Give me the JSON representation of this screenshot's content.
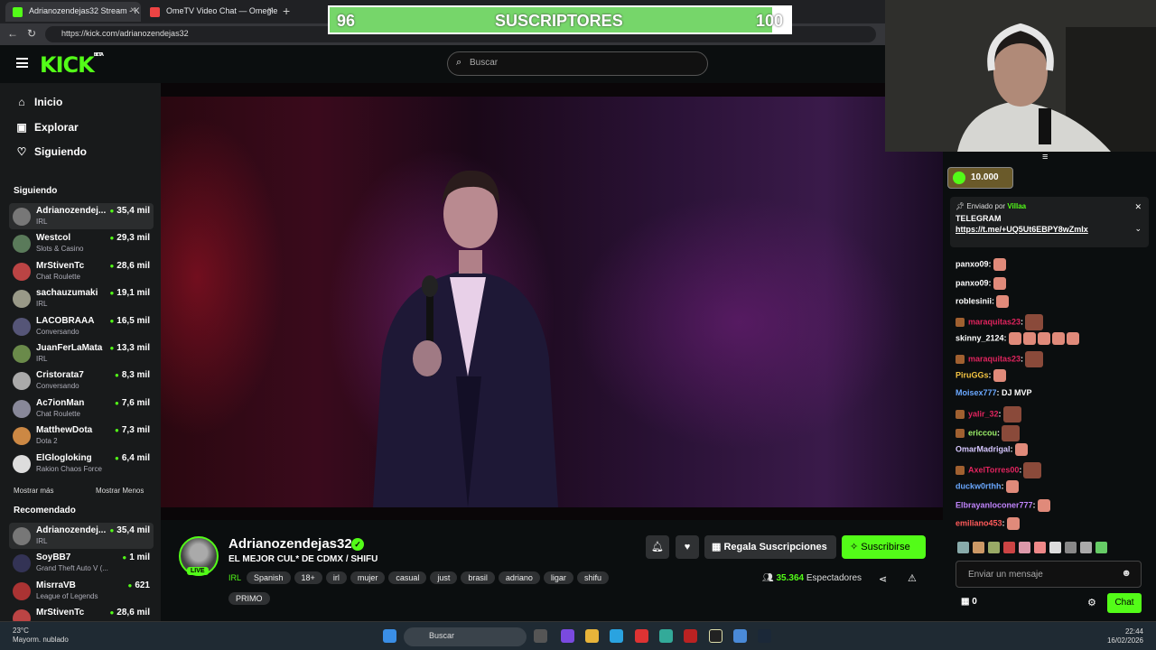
{
  "browser": {
    "tabs": [
      {
        "label": "Adrianozendejas32 Stream - K",
        "active": true,
        "favicon_color": "#53fc18"
      },
      {
        "label": "OmeTV Video Chat — Omegle Ra",
        "active": false,
        "favicon_color": "#e44"
      }
    ],
    "url": "https://kick.com/adrianozendejas32"
  },
  "sub_goal": {
    "current": "96",
    "label": "SUSCRIPTORES",
    "target": "100",
    "progress": 0.96
  },
  "header": {
    "logo": "KICK",
    "logo_badge": "BETA",
    "search_placeholder": "Buscar"
  },
  "sidebar": {
    "nav": [
      {
        "label": "Inicio",
        "icon": "home-icon"
      },
      {
        "label": "Explorar",
        "icon": "compass-icon"
      },
      {
        "label": "Siguiendo",
        "icon": "heart-icon"
      }
    ],
    "following_title": "Siguiendo",
    "following": [
      {
        "name": "Adrianozendej...",
        "category": "IRL",
        "viewers": "35,4 mil",
        "avatar_color": "#777"
      },
      {
        "name": "Westcol",
        "category": "Slots & Casino",
        "viewers": "29,3 mil",
        "avatar_color": "#5a7a5a"
      },
      {
        "name": "MrStivenTc",
        "category": "Chat Roulette",
        "viewers": "28,6 mil",
        "avatar_color": "#b44"
      },
      {
        "name": "sachauzumaki",
        "category": "IRL",
        "viewers": "19,1 mil",
        "avatar_color": "#998"
      },
      {
        "name": "LACOBRAAA",
        "category": "Conversando",
        "viewers": "16,5 mil",
        "avatar_color": "#557"
      },
      {
        "name": "JuanFerLaMata",
        "category": "IRL",
        "viewers": "13,3 mil",
        "avatar_color": "#6a8a4a"
      },
      {
        "name": "Cristorata7",
        "category": "Conversando",
        "viewers": "8,3 mil",
        "avatar_color": "#aaa"
      },
      {
        "name": "Ac7ionMan",
        "category": "Chat Roulette",
        "viewers": "7,6 mil",
        "avatar_color": "#889"
      },
      {
        "name": "MatthewDota",
        "category": "Dota 2",
        "viewers": "7,3 mil",
        "avatar_color": "#c84"
      },
      {
        "name": "ElGlogloking",
        "category": "Rakion Chaos Force",
        "viewers": "6,4 mil",
        "avatar_color": "#ddd"
      }
    ],
    "show_more": "Mostrar más",
    "show_less": "Mostrar Menos",
    "recommended_title": "Recomendado",
    "recommended": [
      {
        "name": "Adrianozendej...",
        "category": "IRL",
        "viewers": "35,4 mil",
        "avatar_color": "#777"
      },
      {
        "name": "SoyBB7",
        "category": "Grand Theft Auto V (...",
        "viewers": "1 mil",
        "avatar_color": "#335"
      },
      {
        "name": "MisrraVB",
        "category": "League of Legends",
        "viewers": "621",
        "avatar_color": "#a33"
      },
      {
        "name": "MrStivenTc",
        "category": "",
        "viewers": "28,6 mil",
        "avatar_color": "#b44"
      }
    ]
  },
  "stream": {
    "streamer": "Adrianozendejas32",
    "live_label": "LIVE",
    "title": "EL MEJOR CUL* DE CDMX  / SHIFU",
    "category": "IRL",
    "tags": [
      "Spanish",
      "18+",
      "irl",
      "mujer",
      "casual",
      "just",
      "brasil",
      "adriano",
      "ligar",
      "shifu",
      "PRIMO"
    ],
    "gift_label": "Regala Suscripciones",
    "subscribe_label": "Suscribirse",
    "viewer_count": "35.364",
    "viewer_label": "Espectadores"
  },
  "chat": {
    "goal_value": "10.000",
    "pinned_sent_by": "Enviado por",
    "pinned_user": "Villaa",
    "pinned_message": "TELEGRAM",
    "pinned_link": "https://t.me/+UQ5Ut6EBPY8wZmIx",
    "messages": [
      {
        "user": "panxo09",
        "color": "#fff",
        "text": "",
        "emotes": 1
      },
      {
        "user": "panxo09",
        "color": "#fff",
        "text": "",
        "emotes": 1
      },
      {
        "user": "roblesinii",
        "color": "#fff",
        "text": "",
        "emotes": 1
      },
      {
        "user": "maraquitas23",
        "color": "#e0245e",
        "text": "",
        "emotes": 1,
        "badge": true
      },
      {
        "user": "skinny_2124",
        "color": "#fff",
        "text": "",
        "emotes": 5
      },
      {
        "user": "maraquitas23",
        "color": "#e0245e",
        "text": "",
        "emotes": 1,
        "badge": true
      },
      {
        "user": "PiruGGs",
        "color": "#f5c542",
        "text": "",
        "emotes": 1
      },
      {
        "user": "Moisex777",
        "color": "#6aa8ff",
        "text": "DJ MVP",
        "emotes": 0
      },
      {
        "user": "yalir_32",
        "color": "#e0245e",
        "text": "",
        "emotes": 1,
        "badge": true
      },
      {
        "user": "ericcou",
        "color": "#9cf06a",
        "text": "",
        "emotes": 1,
        "badge": true
      },
      {
        "user": "OmarMadrigal",
        "color": "#d6c7ff",
        "text": "",
        "emotes": 1
      },
      {
        "user": "AxelTorres00",
        "color": "#e0245e",
        "text": "",
        "emotes": 1,
        "badge": true
      },
      {
        "user": "duckw0rthh",
        "color": "#6aa8ff",
        "text": "",
        "emotes": 1
      },
      {
        "user": "Elbrayanloconer777",
        "color": "#c084fc",
        "text": "",
        "emotes": 1
      },
      {
        "user": "emiliano453",
        "color": "#ff5a5a",
        "text": "",
        "emotes": 1
      }
    ],
    "input_placeholder": "Enviar un mensaje",
    "points": "0",
    "send_label": "Chat"
  },
  "taskbar": {
    "temperature": "23°C",
    "weather": "Mayorm. nublado",
    "search": "Buscar",
    "time": "22:44",
    "date": "16/02/2026"
  }
}
